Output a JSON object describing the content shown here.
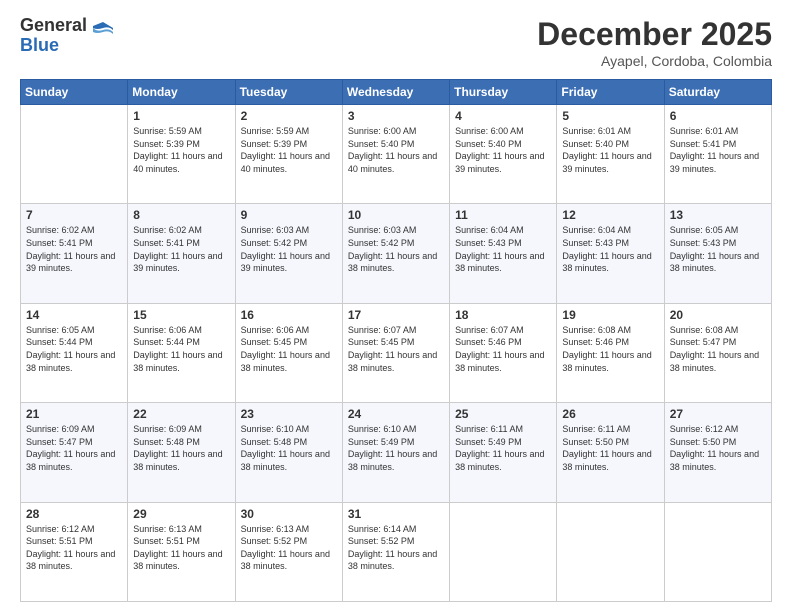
{
  "header": {
    "logo_general": "General",
    "logo_blue": "Blue",
    "month_title": "December 2025",
    "location": "Ayapel, Cordoba, Colombia"
  },
  "weekdays": [
    "Sunday",
    "Monday",
    "Tuesday",
    "Wednesday",
    "Thursday",
    "Friday",
    "Saturday"
  ],
  "weeks": [
    [
      {
        "day": "",
        "sunrise": "",
        "sunset": "",
        "daylight": ""
      },
      {
        "day": "1",
        "sunrise": "Sunrise: 5:59 AM",
        "sunset": "Sunset: 5:39 PM",
        "daylight": "Daylight: 11 hours and 40 minutes."
      },
      {
        "day": "2",
        "sunrise": "Sunrise: 5:59 AM",
        "sunset": "Sunset: 5:39 PM",
        "daylight": "Daylight: 11 hours and 40 minutes."
      },
      {
        "day": "3",
        "sunrise": "Sunrise: 6:00 AM",
        "sunset": "Sunset: 5:40 PM",
        "daylight": "Daylight: 11 hours and 40 minutes."
      },
      {
        "day": "4",
        "sunrise": "Sunrise: 6:00 AM",
        "sunset": "Sunset: 5:40 PM",
        "daylight": "Daylight: 11 hours and 39 minutes."
      },
      {
        "day": "5",
        "sunrise": "Sunrise: 6:01 AM",
        "sunset": "Sunset: 5:40 PM",
        "daylight": "Daylight: 11 hours and 39 minutes."
      },
      {
        "day": "6",
        "sunrise": "Sunrise: 6:01 AM",
        "sunset": "Sunset: 5:41 PM",
        "daylight": "Daylight: 11 hours and 39 minutes."
      }
    ],
    [
      {
        "day": "7",
        "sunrise": "Sunrise: 6:02 AM",
        "sunset": "Sunset: 5:41 PM",
        "daylight": "Daylight: 11 hours and 39 minutes."
      },
      {
        "day": "8",
        "sunrise": "Sunrise: 6:02 AM",
        "sunset": "Sunset: 5:41 PM",
        "daylight": "Daylight: 11 hours and 39 minutes."
      },
      {
        "day": "9",
        "sunrise": "Sunrise: 6:03 AM",
        "sunset": "Sunset: 5:42 PM",
        "daylight": "Daylight: 11 hours and 39 minutes."
      },
      {
        "day": "10",
        "sunrise": "Sunrise: 6:03 AM",
        "sunset": "Sunset: 5:42 PM",
        "daylight": "Daylight: 11 hours and 38 minutes."
      },
      {
        "day": "11",
        "sunrise": "Sunrise: 6:04 AM",
        "sunset": "Sunset: 5:43 PM",
        "daylight": "Daylight: 11 hours and 38 minutes."
      },
      {
        "day": "12",
        "sunrise": "Sunrise: 6:04 AM",
        "sunset": "Sunset: 5:43 PM",
        "daylight": "Daylight: 11 hours and 38 minutes."
      },
      {
        "day": "13",
        "sunrise": "Sunrise: 6:05 AM",
        "sunset": "Sunset: 5:43 PM",
        "daylight": "Daylight: 11 hours and 38 minutes."
      }
    ],
    [
      {
        "day": "14",
        "sunrise": "Sunrise: 6:05 AM",
        "sunset": "Sunset: 5:44 PM",
        "daylight": "Daylight: 11 hours and 38 minutes."
      },
      {
        "day": "15",
        "sunrise": "Sunrise: 6:06 AM",
        "sunset": "Sunset: 5:44 PM",
        "daylight": "Daylight: 11 hours and 38 minutes."
      },
      {
        "day": "16",
        "sunrise": "Sunrise: 6:06 AM",
        "sunset": "Sunset: 5:45 PM",
        "daylight": "Daylight: 11 hours and 38 minutes."
      },
      {
        "day": "17",
        "sunrise": "Sunrise: 6:07 AM",
        "sunset": "Sunset: 5:45 PM",
        "daylight": "Daylight: 11 hours and 38 minutes."
      },
      {
        "day": "18",
        "sunrise": "Sunrise: 6:07 AM",
        "sunset": "Sunset: 5:46 PM",
        "daylight": "Daylight: 11 hours and 38 minutes."
      },
      {
        "day": "19",
        "sunrise": "Sunrise: 6:08 AM",
        "sunset": "Sunset: 5:46 PM",
        "daylight": "Daylight: 11 hours and 38 minutes."
      },
      {
        "day": "20",
        "sunrise": "Sunrise: 6:08 AM",
        "sunset": "Sunset: 5:47 PM",
        "daylight": "Daylight: 11 hours and 38 minutes."
      }
    ],
    [
      {
        "day": "21",
        "sunrise": "Sunrise: 6:09 AM",
        "sunset": "Sunset: 5:47 PM",
        "daylight": "Daylight: 11 hours and 38 minutes."
      },
      {
        "day": "22",
        "sunrise": "Sunrise: 6:09 AM",
        "sunset": "Sunset: 5:48 PM",
        "daylight": "Daylight: 11 hours and 38 minutes."
      },
      {
        "day": "23",
        "sunrise": "Sunrise: 6:10 AM",
        "sunset": "Sunset: 5:48 PM",
        "daylight": "Daylight: 11 hours and 38 minutes."
      },
      {
        "day": "24",
        "sunrise": "Sunrise: 6:10 AM",
        "sunset": "Sunset: 5:49 PM",
        "daylight": "Daylight: 11 hours and 38 minutes."
      },
      {
        "day": "25",
        "sunrise": "Sunrise: 6:11 AM",
        "sunset": "Sunset: 5:49 PM",
        "daylight": "Daylight: 11 hours and 38 minutes."
      },
      {
        "day": "26",
        "sunrise": "Sunrise: 6:11 AM",
        "sunset": "Sunset: 5:50 PM",
        "daylight": "Daylight: 11 hours and 38 minutes."
      },
      {
        "day": "27",
        "sunrise": "Sunrise: 6:12 AM",
        "sunset": "Sunset: 5:50 PM",
        "daylight": "Daylight: 11 hours and 38 minutes."
      }
    ],
    [
      {
        "day": "28",
        "sunrise": "Sunrise: 6:12 AM",
        "sunset": "Sunset: 5:51 PM",
        "daylight": "Daylight: 11 hours and 38 minutes."
      },
      {
        "day": "29",
        "sunrise": "Sunrise: 6:13 AM",
        "sunset": "Sunset: 5:51 PM",
        "daylight": "Daylight: 11 hours and 38 minutes."
      },
      {
        "day": "30",
        "sunrise": "Sunrise: 6:13 AM",
        "sunset": "Sunset: 5:52 PM",
        "daylight": "Daylight: 11 hours and 38 minutes."
      },
      {
        "day": "31",
        "sunrise": "Sunrise: 6:14 AM",
        "sunset": "Sunset: 5:52 PM",
        "daylight": "Daylight: 11 hours and 38 minutes."
      },
      {
        "day": "",
        "sunrise": "",
        "sunset": "",
        "daylight": ""
      },
      {
        "day": "",
        "sunrise": "",
        "sunset": "",
        "daylight": ""
      },
      {
        "day": "",
        "sunrise": "",
        "sunset": "",
        "daylight": ""
      }
    ]
  ]
}
